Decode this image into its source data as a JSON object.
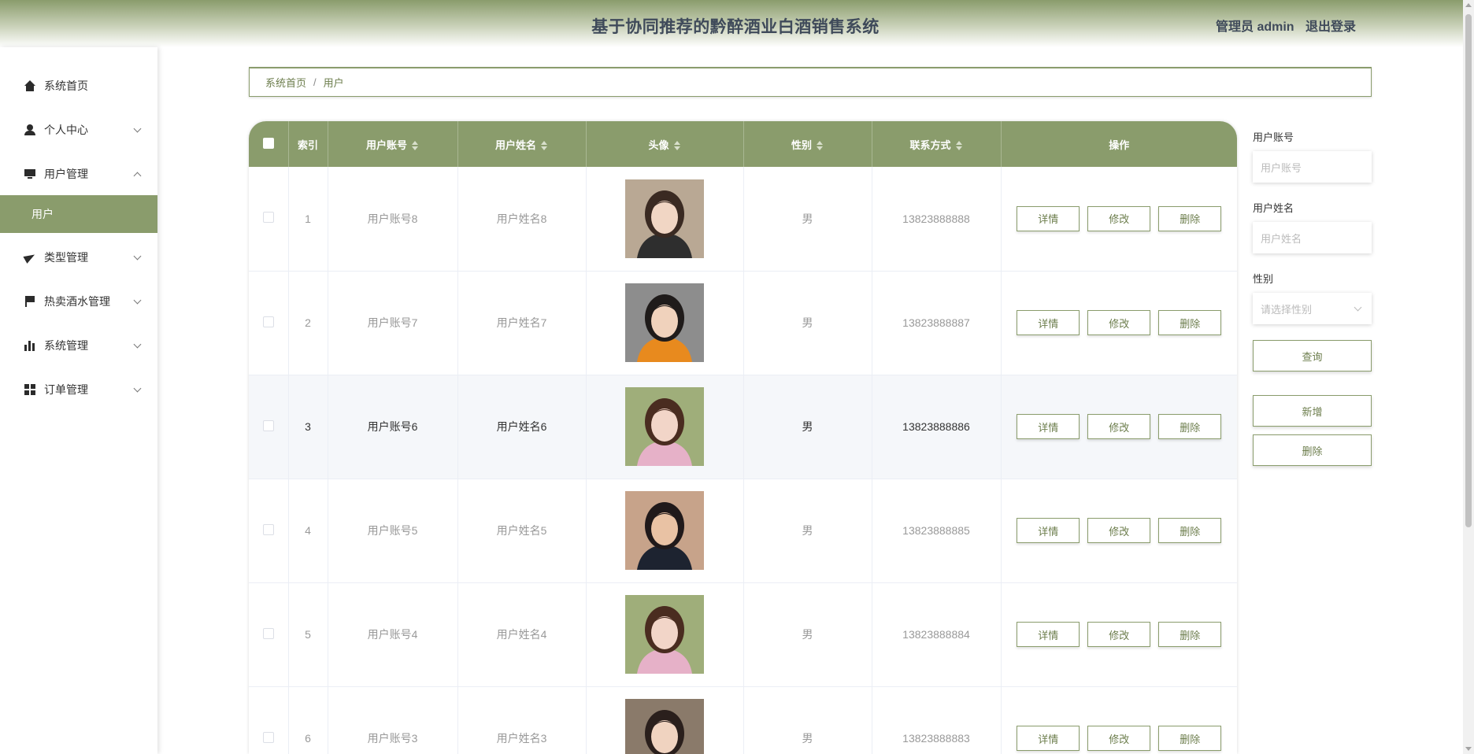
{
  "header": {
    "title": "基于协同推荐的黔醉酒业白酒销售系统",
    "user": "管理员 admin",
    "logout": "退出登录"
  },
  "sidebar": {
    "items": [
      {
        "label": "系统首页",
        "icon": "home-icon"
      },
      {
        "label": "个人中心",
        "icon": "user-icon",
        "expand": "chevron-down"
      },
      {
        "label": "用户管理",
        "icon": "monitor-icon",
        "expand": "chevron-up"
      },
      {
        "label": "类型管理",
        "icon": "paper-plane-icon",
        "expand": "chevron-down"
      },
      {
        "label": "热卖酒水管理",
        "icon": "flag-icon",
        "expand": "chevron-down"
      },
      {
        "label": "系统管理",
        "icon": "bar-chart-icon",
        "expand": "chevron-down"
      },
      {
        "label": "订单管理",
        "icon": "grid-icon",
        "expand": "chevron-down"
      }
    ],
    "active_sub": "用户"
  },
  "breadcrumb": {
    "home": "系统首页",
    "sep": "/",
    "current": "用户"
  },
  "table": {
    "headers": [
      "索引",
      "用户账号",
      "用户姓名",
      "头像",
      "性别",
      "联系方式",
      "操作"
    ],
    "rows": [
      {
        "index": "1",
        "account": "用户账号8",
        "name": "用户姓名8",
        "gender": "男",
        "phone": "13823888888",
        "avatar": "avatar-woman-longhair"
      },
      {
        "index": "2",
        "account": "用户账号7",
        "name": "用户姓名7",
        "gender": "男",
        "phone": "13823888887",
        "avatar": "avatar-man-orange"
      },
      {
        "index": "3",
        "account": "用户账号6",
        "name": "用户姓名6",
        "gender": "男",
        "phone": "13823888886",
        "avatar": "avatar-woman-pink"
      },
      {
        "index": "4",
        "account": "用户账号5",
        "name": "用户姓名5",
        "gender": "男",
        "phone": "13823888885",
        "avatar": "avatar-man-tank"
      },
      {
        "index": "5",
        "account": "用户账号4",
        "name": "用户姓名4",
        "gender": "男",
        "phone": "13823888884",
        "avatar": "avatar-woman-pink"
      },
      {
        "index": "6",
        "account": "用户账号3",
        "name": "用户姓名3",
        "gender": "男",
        "phone": "13823888883",
        "avatar": "avatar-woman-hat"
      }
    ],
    "actions": {
      "detail": "详情",
      "edit": "修改",
      "delete": "删除"
    }
  },
  "search": {
    "account_label": "用户账号",
    "account_placeholder": "用户账号",
    "name_label": "用户姓名",
    "name_placeholder": "用户姓名",
    "gender_label": "性别",
    "gender_placeholder": "请选择性别",
    "query": "查询",
    "add": "新增",
    "delete": "删除"
  },
  "colors": {
    "accent": "#8a9c6c",
    "title": "#3f4a5a"
  }
}
